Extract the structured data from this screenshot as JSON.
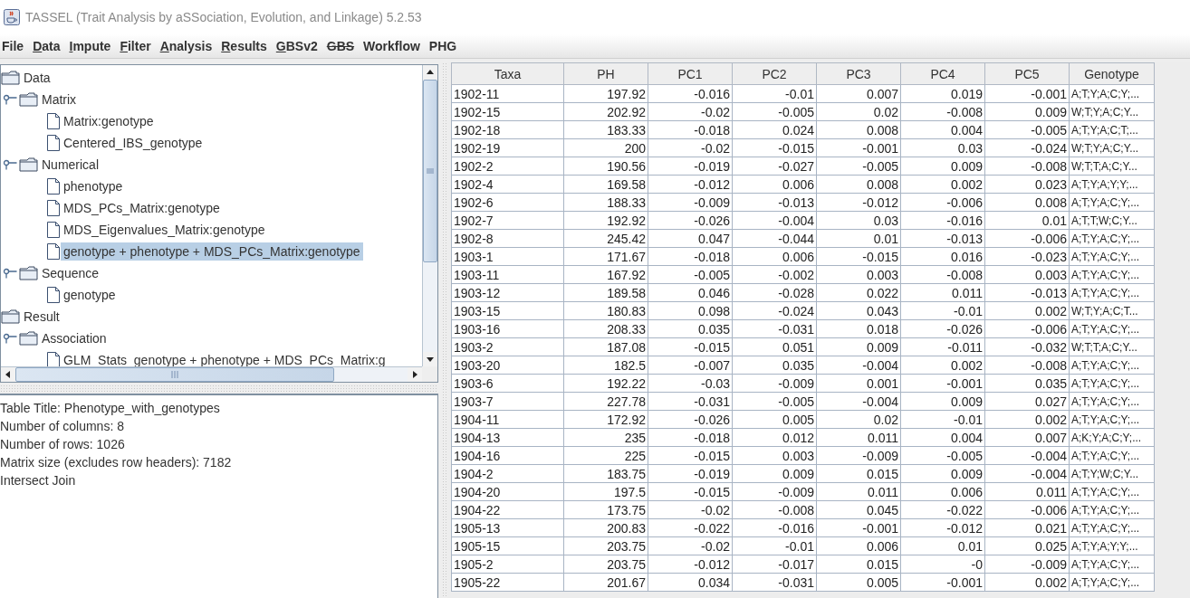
{
  "window": {
    "title": "TASSEL (Trait Analysis by aSSociation, Evolution, and Linkage) 5.2.53"
  },
  "menu": [
    {
      "label": "File",
      "mnemonic": false,
      "struck": false
    },
    {
      "label": "Data",
      "mnemonic": true,
      "struck": false
    },
    {
      "label": "Impute",
      "mnemonic": true,
      "struck": false
    },
    {
      "label": "Filter",
      "mnemonic": true,
      "struck": false
    },
    {
      "label": "Analysis",
      "mnemonic": true,
      "struck": false
    },
    {
      "label": "Results",
      "mnemonic": true,
      "struck": false
    },
    {
      "label": "GBSv2",
      "mnemonic": true,
      "struck": false
    },
    {
      "label": "GBS",
      "mnemonic": false,
      "struck": true
    },
    {
      "label": "Workflow",
      "mnemonic": false,
      "struck": false
    },
    {
      "label": "PHG",
      "mnemonic": false,
      "struck": false
    }
  ],
  "tree": [
    {
      "label": "Data",
      "kind": "folder",
      "selected": false,
      "children": [
        {
          "label": "Matrix",
          "kind": "folder",
          "expanded": true,
          "selected": false,
          "children": [
            {
              "label": "Matrix:genotype",
              "kind": "file",
              "selected": false
            },
            {
              "label": "Centered_IBS_genotype",
              "kind": "file",
              "selected": false
            }
          ]
        },
        {
          "label": "Numerical",
          "kind": "folder",
          "expanded": true,
          "selected": false,
          "children": [
            {
              "label": "phenotype",
              "kind": "file",
              "selected": false
            },
            {
              "label": "MDS_PCs_Matrix:genotype",
              "kind": "file",
              "selected": false
            },
            {
              "label": "MDS_Eigenvalues_Matrix:genotype",
              "kind": "file",
              "selected": false
            },
            {
              "label": "genotype + phenotype + MDS_PCs_Matrix:genotype",
              "kind": "file",
              "selected": true
            }
          ]
        },
        {
          "label": "Sequence",
          "kind": "folder",
          "expanded": true,
          "selected": false,
          "children": [
            {
              "label": "genotype",
              "kind": "file",
              "selected": false
            }
          ]
        }
      ]
    },
    {
      "label": "Result",
      "kind": "folder",
      "selected": false,
      "children": [
        {
          "label": "Association",
          "kind": "folder",
          "expanded": true,
          "selected": false,
          "children": [
            {
              "label": "GLM_Stats_genotype + phenotype + MDS_PCs_Matrix:g",
              "kind": "file",
              "selected": false
            }
          ]
        }
      ]
    }
  ],
  "info": [
    "Table Title: Phenotype_with_genotypes",
    "Number of columns: 8",
    "Number of rows: 1026",
    "Matrix size (excludes row headers): 7182",
    "Intersect Join"
  ],
  "table": {
    "columns": [
      {
        "label": "Taxa",
        "kind": "text"
      },
      {
        "label": "PH",
        "kind": "number"
      },
      {
        "label": "PC1",
        "kind": "number"
      },
      {
        "label": "PC2",
        "kind": "number"
      },
      {
        "label": "PC3",
        "kind": "number"
      },
      {
        "label": "PC4",
        "kind": "number"
      },
      {
        "label": "PC5",
        "kind": "number"
      },
      {
        "label": "Genotype",
        "kind": "sequence"
      }
    ],
    "rows": [
      [
        "1902-11",
        "197.92",
        "-0.016",
        "-0.01",
        "0.007",
        "0.019",
        "-0.001",
        "A;T;Y;A;C;Y;..."
      ],
      [
        "1902-15",
        "202.92",
        "-0.02",
        "-0.005",
        "0.02",
        "-0.008",
        "0.009",
        "W;T;Y;A;C;Y..."
      ],
      [
        "1902-18",
        "183.33",
        "-0.018",
        "0.024",
        "0.008",
        "0.004",
        "-0.005",
        "A;T;Y;A;C;T;..."
      ],
      [
        "1902-19",
        "200",
        "-0.02",
        "-0.015",
        "-0.001",
        "0.03",
        "-0.024",
        "W;T;Y;A;C;Y..."
      ],
      [
        "1902-2",
        "190.56",
        "-0.019",
        "-0.027",
        "-0.005",
        "0.009",
        "-0.008",
        "W;T;T;A;C;Y..."
      ],
      [
        "1902-4",
        "169.58",
        "-0.012",
        "0.006",
        "0.008",
        "0.002",
        "0.023",
        "A;T;Y;A;Y;Y;..."
      ],
      [
        "1902-6",
        "188.33",
        "-0.009",
        "-0.013",
        "-0.012",
        "-0.006",
        "0.008",
        "A;T;Y;A;C;Y;..."
      ],
      [
        "1902-7",
        "192.92",
        "-0.026",
        "-0.004",
        "0.03",
        "-0.016",
        "0.01",
        "A;T;T;W;C;Y..."
      ],
      [
        "1902-8",
        "245.42",
        "0.047",
        "-0.044",
        "0.01",
        "-0.013",
        "-0.006",
        "A;T;Y;A;C;Y;..."
      ],
      [
        "1903-1",
        "171.67",
        "-0.018",
        "0.006",
        "-0.015",
        "0.016",
        "-0.023",
        "A;T;Y;A;C;Y;..."
      ],
      [
        "1903-11",
        "167.92",
        "-0.005",
        "-0.002",
        "0.003",
        "-0.008",
        "0.003",
        "A;T;Y;A;C;Y;..."
      ],
      [
        "1903-12",
        "189.58",
        "0.046",
        "-0.028",
        "0.022",
        "0.011",
        "-0.013",
        "A;T;Y;A;C;Y;..."
      ],
      [
        "1903-15",
        "180.83",
        "0.098",
        "-0.024",
        "0.043",
        "-0.01",
        "0.002",
        "W;T;Y;A;C;T..."
      ],
      [
        "1903-16",
        "208.33",
        "0.035",
        "-0.031",
        "0.018",
        "-0.026",
        "-0.006",
        "A;T;Y;A;C;Y;..."
      ],
      [
        "1903-2",
        "187.08",
        "-0.015",
        "0.051",
        "0.009",
        "-0.011",
        "-0.032",
        "W;T;T;A;C;Y..."
      ],
      [
        "1903-20",
        "182.5",
        "-0.007",
        "0.035",
        "-0.004",
        "0.002",
        "-0.008",
        "A;T;Y;A;C;Y;..."
      ],
      [
        "1903-6",
        "192.22",
        "-0.03",
        "-0.009",
        "0.001",
        "-0.001",
        "0.035",
        "A;T;Y;A;C;Y;..."
      ],
      [
        "1903-7",
        "227.78",
        "-0.031",
        "-0.005",
        "-0.004",
        "0.009",
        "0.027",
        "A;T;Y;A;C;Y;..."
      ],
      [
        "1904-11",
        "172.92",
        "-0.026",
        "0.005",
        "0.02",
        "-0.01",
        "0.002",
        "A;T;Y;A;C;Y;..."
      ],
      [
        "1904-13",
        "235",
        "-0.018",
        "0.012",
        "0.011",
        "0.004",
        "0.007",
        "A;K;Y;A;C;Y;..."
      ],
      [
        "1904-16",
        "225",
        "-0.015",
        "0.003",
        "-0.009",
        "-0.005",
        "-0.004",
        "A;T;Y;A;C;Y;..."
      ],
      [
        "1904-2",
        "183.75",
        "-0.019",
        "0.009",
        "0.015",
        "0.009",
        "-0.004",
        "A;T;Y;W;C;Y..."
      ],
      [
        "1904-20",
        "197.5",
        "-0.015",
        "-0.009",
        "0.011",
        "0.006",
        "0.011",
        "A;T;Y;A;C;Y;..."
      ],
      [
        "1904-22",
        "173.75",
        "-0.02",
        "-0.008",
        "0.045",
        "-0.022",
        "-0.006",
        "A;T;Y;A;C;Y;..."
      ],
      [
        "1905-13",
        "200.83",
        "-0.022",
        "-0.016",
        "-0.001",
        "-0.012",
        "0.021",
        "A;T;Y;A;C;Y;..."
      ],
      [
        "1905-15",
        "203.75",
        "-0.02",
        "-0.01",
        "0.006",
        "0.01",
        "0.025",
        "A;T;Y;A;Y;Y;..."
      ],
      [
        "1905-2",
        "203.75",
        "-0.012",
        "-0.017",
        "0.015",
        "-0",
        "-0.009",
        "A;T;Y;A;C;Y;..."
      ],
      [
        "1905-22",
        "201.67",
        "0.034",
        "-0.031",
        "0.005",
        "-0.001",
        "0.002",
        "A;T;Y;A;C;Y;..."
      ]
    ]
  }
}
